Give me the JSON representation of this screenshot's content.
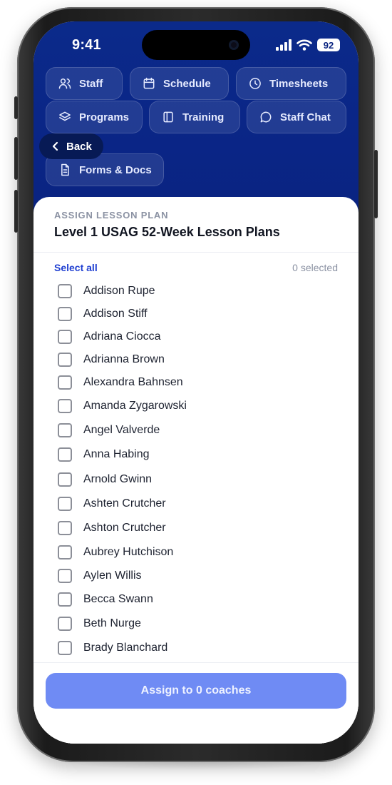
{
  "status_bar": {
    "time": "9:41",
    "battery": "92"
  },
  "nav": {
    "chips": [
      {
        "label": "Staff",
        "icon": "users-icon"
      },
      {
        "label": "Schedule",
        "icon": "calendar-icon"
      },
      {
        "label": "Timesheets",
        "icon": "clock-icon"
      },
      {
        "label": "Programs",
        "icon": "layers-icon"
      },
      {
        "label": "Training",
        "icon": "book-icon"
      },
      {
        "label": "Staff Chat",
        "icon": "chat-bubble-icon"
      },
      {
        "label": "Forms & Docs",
        "icon": "document-icon"
      }
    ],
    "back_label": "Back"
  },
  "sheet": {
    "eyebrow": "ASSIGN LESSON PLAN",
    "title": "Level 1 USAG 52-Week Lesson Plans",
    "select_all": "Select all",
    "selected_count": "0 selected",
    "coaches": [
      "Addison Rupe",
      "Addison Stiff",
      "Adriana Ciocca",
      "Adrianna Brown",
      "Alexandra Bahnsen",
      "Amanda Zygarowski",
      "Angel Valverde",
      "Anna Habing",
      "Arnold Gwinn",
      "Ashten Crutcher",
      "Ashton Crutcher",
      "Aubrey Hutchison",
      "Aylen Willis",
      "Becca Swann",
      "Beth Nurge",
      "Brady Blanchard"
    ],
    "assign_button": "Assign to 0 coaches"
  },
  "colors": {
    "hero": "#0a2586",
    "accent": "#1f3fd1",
    "button": "#6f8bf4"
  }
}
